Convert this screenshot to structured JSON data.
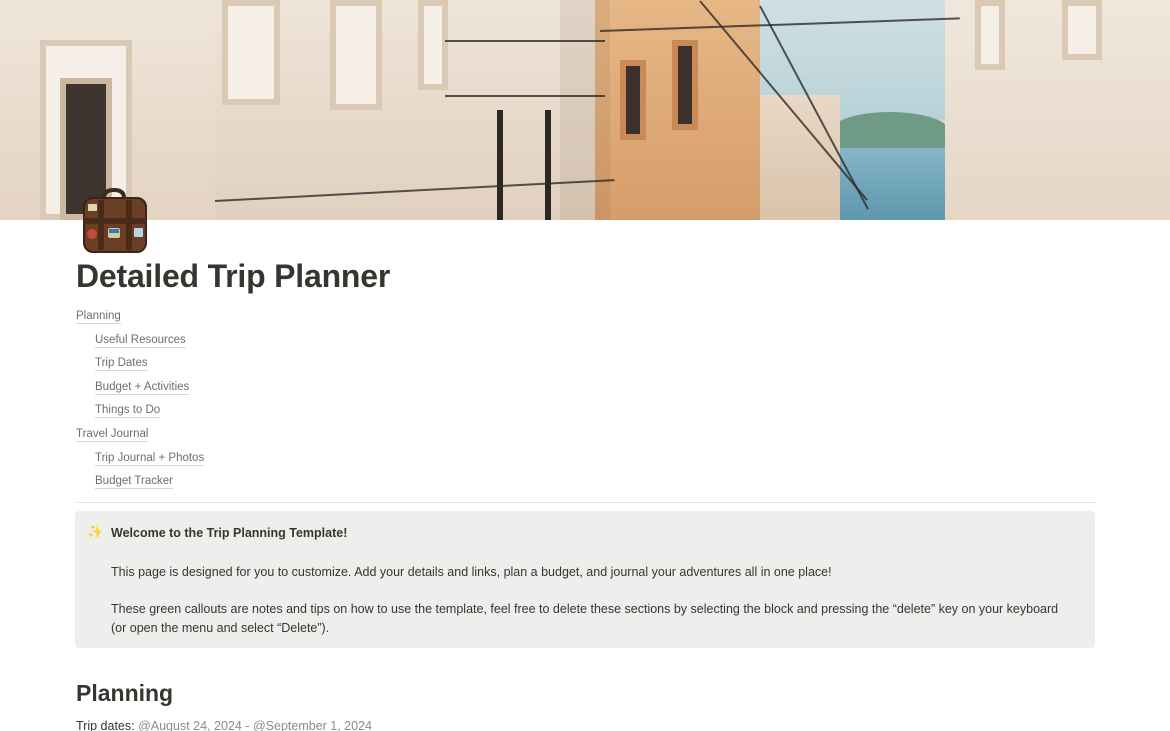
{
  "page": {
    "title": "Detailed Trip Planner",
    "icon": "suitcase-icon"
  },
  "toc": [
    {
      "label": "Planning",
      "level": 1
    },
    {
      "label": "Useful Resources",
      "level": 2
    },
    {
      "label": "Trip Dates",
      "level": 2
    },
    {
      "label": "Budget + Activities",
      "level": 2
    },
    {
      "label": "Things to Do",
      "level": 2
    },
    {
      "label": "Travel Journal",
      "level": 1
    },
    {
      "label": "Trip Journal + Photos",
      "level": 2
    },
    {
      "label": "Budget Tracker",
      "level": 2
    }
  ],
  "callout": {
    "icon": "sparkles-icon",
    "heading": "Welcome to the Trip Planning Template!",
    "paragraph1": "This page is designed for you to customize. Add your details and links, plan a budget, and journal your adventures all in one place!",
    "paragraph2": "These green callouts are notes and tips on how to use the template, feel free to delete these sections by selecting the block and pressing the “delete” key on your keyboard (or open the menu and select “Delete”).",
    "background": "#edefec"
  },
  "planning": {
    "heading": "Planning",
    "dates_label": "Trip dates:",
    "start_date": "@August 24, 2024",
    "separator": "-",
    "end_date": "@September 1, 2024"
  },
  "colors": {
    "text": "#37352f",
    "muted": "#6f6e69",
    "accent_sparkle": "#d9a21a"
  }
}
